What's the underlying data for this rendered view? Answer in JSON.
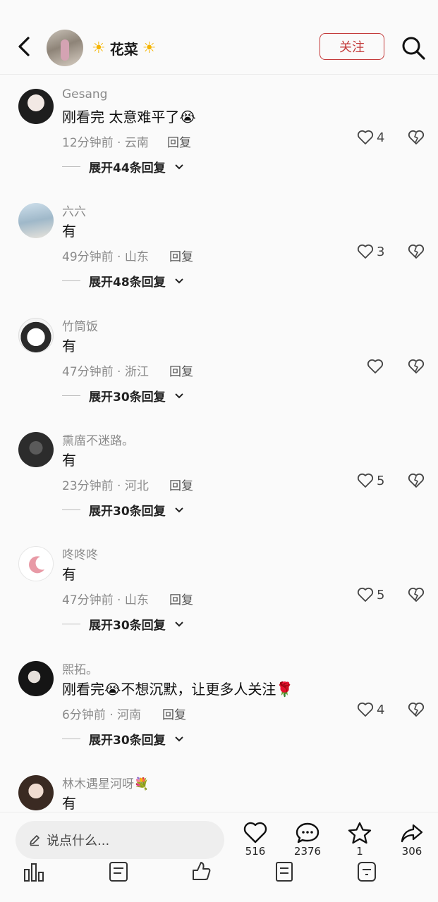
{
  "header": {
    "author_name": "花菜",
    "sun_left": "☀",
    "sun_right": "☀",
    "follow_label": "关注"
  },
  "comments": [
    {
      "user": "Gesang",
      "text": "刚看完 太意难平了😭",
      "time_loc": "12分钟前 · 云南",
      "reply": "回复",
      "likes": "4",
      "expand": "展开44条回复"
    },
    {
      "user": "六六",
      "text": "有",
      "time_loc": "49分钟前 · 山东",
      "reply": "回复",
      "likes": "3",
      "expand": "展开48条回复"
    },
    {
      "user": "竹筒饭",
      "text": "有",
      "time_loc": "47分钟前 · 浙江",
      "reply": "回复",
      "likes": "",
      "expand": "展开30条回复"
    },
    {
      "user": "熏庿不迷路。",
      "text": "有",
      "time_loc": "23分钟前 · 河北",
      "reply": "回复",
      "likes": "5",
      "expand": "展开30条回复"
    },
    {
      "user": "咚咚咚",
      "text": "有",
      "time_loc": "47分钟前 · 山东",
      "reply": "回复",
      "likes": "5",
      "expand": "展开30条回复"
    },
    {
      "user": "煕拓。",
      "text": "刚看完😭不想沉默，让更多人关注🌹",
      "time_loc": "6分钟前 · 河南",
      "reply": "回复",
      "likes": "4",
      "expand": "展开30条回复"
    },
    {
      "user": "林木遇星河呀💐",
      "text": "有",
      "time_loc": "",
      "reply": "",
      "likes": "",
      "expand": ""
    }
  ],
  "bottom": {
    "input_placeholder": "说点什么...",
    "like_count": "516",
    "comment_count": "2376",
    "star_count": "1",
    "share_count": "306"
  },
  "icons": {
    "back": "back-arrow-icon",
    "search": "search-icon",
    "like": "heart-icon",
    "dislike": "broken-heart-icon",
    "edit": "pencil-icon",
    "comment": "chat-bubble-icon",
    "star": "star-icon",
    "share": "share-icon"
  },
  "colors": {
    "accent": "#c33a3a",
    "muted": "#8a8a8a"
  }
}
